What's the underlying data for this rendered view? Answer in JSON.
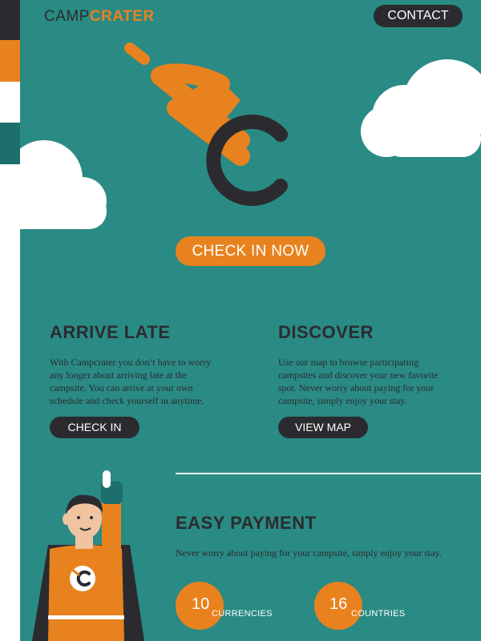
{
  "brand": {
    "camp": "CAMP",
    "crater": "CRATER",
    "colors": {
      "teal": "#2a8a84",
      "orange": "#e8821e",
      "dark": "#2b2b2f",
      "white": "#ffffff"
    }
  },
  "header": {
    "contact_label": "CONTACT"
  },
  "hero": {
    "cta_label": "CHECK IN NOW",
    "emblem_icon": "meteor-c-logo-icon"
  },
  "features": [
    {
      "title": "ARRIVE LATE",
      "text": "With Campcrater you don’t have to worry any longer about arriving late at the campsite. You can arrive at your own schedule and check yourself in anytime.",
      "button": "CHECK IN"
    },
    {
      "title": "DISCOVER",
      "text": "Use our map to browse participating campsites and discover your new favorite spot. Never worry about paying for your campsite, simply enjoy your stay.",
      "button": "VIEW MAP"
    }
  ],
  "payment": {
    "title": "EASY PAYMENT",
    "text": "Never worry about paying for your campsite, simply enjoy your stay.",
    "stats": [
      {
        "value": "10",
        "label": "CURRENCIES"
      },
      {
        "value": "16",
        "label": "COUNTRIES"
      }
    ]
  }
}
